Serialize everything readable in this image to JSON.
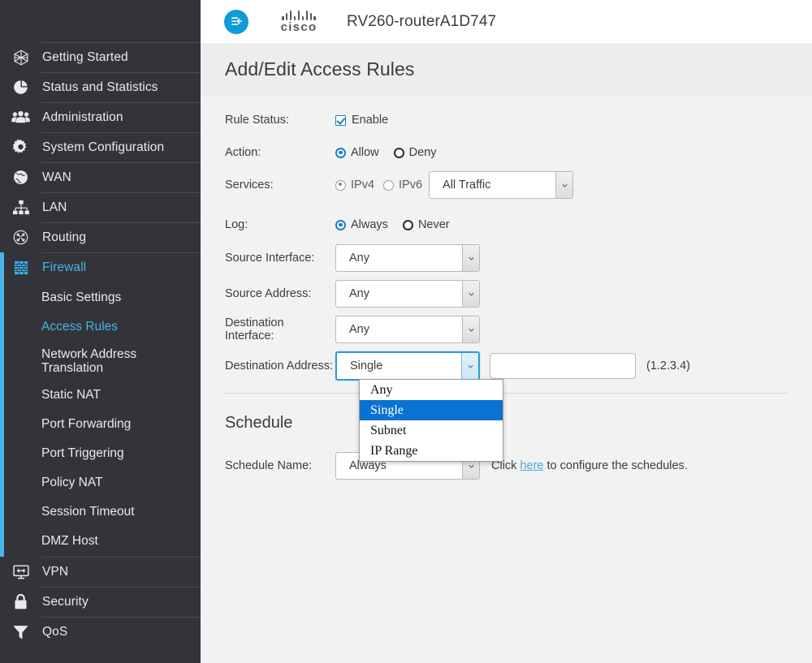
{
  "header": {
    "collapse_icon": "collapse-menu-icon",
    "brand": "cisco",
    "device_name": "RV260-routerA1D747"
  },
  "page": {
    "title": "Add/Edit Access Rules"
  },
  "sidebar": {
    "accent_color": "#4ab3e8",
    "background": "#32343a",
    "items": [
      {
        "label": "Getting Started",
        "icon": "hexagon-network-icon",
        "active": false
      },
      {
        "label": "Status and Statistics",
        "icon": "pie-chart-icon",
        "active": false
      },
      {
        "label": "Administration",
        "icon": "users-icon",
        "active": false
      },
      {
        "label": "System Configuration",
        "icon": "gear-icon",
        "active": false
      },
      {
        "label": "WAN",
        "icon": "globe-icon",
        "active": false
      },
      {
        "label": "LAN",
        "icon": "network-tree-icon",
        "active": false
      },
      {
        "label": "Routing",
        "icon": "routing-arrows-icon",
        "active": false
      },
      {
        "label": "Firewall",
        "icon": "firewall-brick-icon",
        "active": true
      }
    ],
    "firewall_subitems": [
      {
        "label": "Basic Settings",
        "active": false
      },
      {
        "label": "Access Rules",
        "active": true
      },
      {
        "label": "Network Address Translation",
        "active": false
      },
      {
        "label": "Static NAT",
        "active": false
      },
      {
        "label": "Port Forwarding",
        "active": false
      },
      {
        "label": "Port Triggering",
        "active": false
      },
      {
        "label": "Policy NAT",
        "active": false
      },
      {
        "label": "Session Timeout",
        "active": false
      },
      {
        "label": "DMZ Host",
        "active": false
      }
    ],
    "bottom_items": [
      {
        "label": "VPN",
        "icon": "vpn-monitor-icon"
      },
      {
        "label": "Security",
        "icon": "lock-icon"
      },
      {
        "label": "QoS",
        "icon": "funnel-icon"
      }
    ]
  },
  "form": {
    "rule_status": {
      "label": "Rule Status:",
      "checkbox_label": "Enable",
      "checked": true
    },
    "action": {
      "label": "Action:",
      "options": [
        "Allow",
        "Deny"
      ],
      "selected": "Allow"
    },
    "services": {
      "label": "Services:",
      "ip_options": [
        "IPv4",
        "IPv6"
      ],
      "ip_selected": "IPv4",
      "select_value": "All Traffic"
    },
    "log": {
      "label": "Log:",
      "options": [
        "Always",
        "Never"
      ],
      "selected": "Always"
    },
    "source_interface": {
      "label": "Source Interface:",
      "value": "Any"
    },
    "source_address": {
      "label": "Source Address:",
      "value": "Any"
    },
    "destination_interface": {
      "label": "Destination Interface:",
      "value": "Any"
    },
    "destination_address": {
      "label": "Destination Address:",
      "value": "Single",
      "text_value": "",
      "hint": "(1.2.3.4)",
      "open": true,
      "options": [
        "Any",
        "Single",
        "Subnet",
        "IP Range"
      ],
      "highlighted": "Single"
    }
  },
  "schedule": {
    "section_title": "Schedule",
    "name_label": "Schedule Name:",
    "name_value": "Always",
    "note_prefix": "Click ",
    "note_link": "here",
    "note_suffix": " to configure the schedules."
  }
}
